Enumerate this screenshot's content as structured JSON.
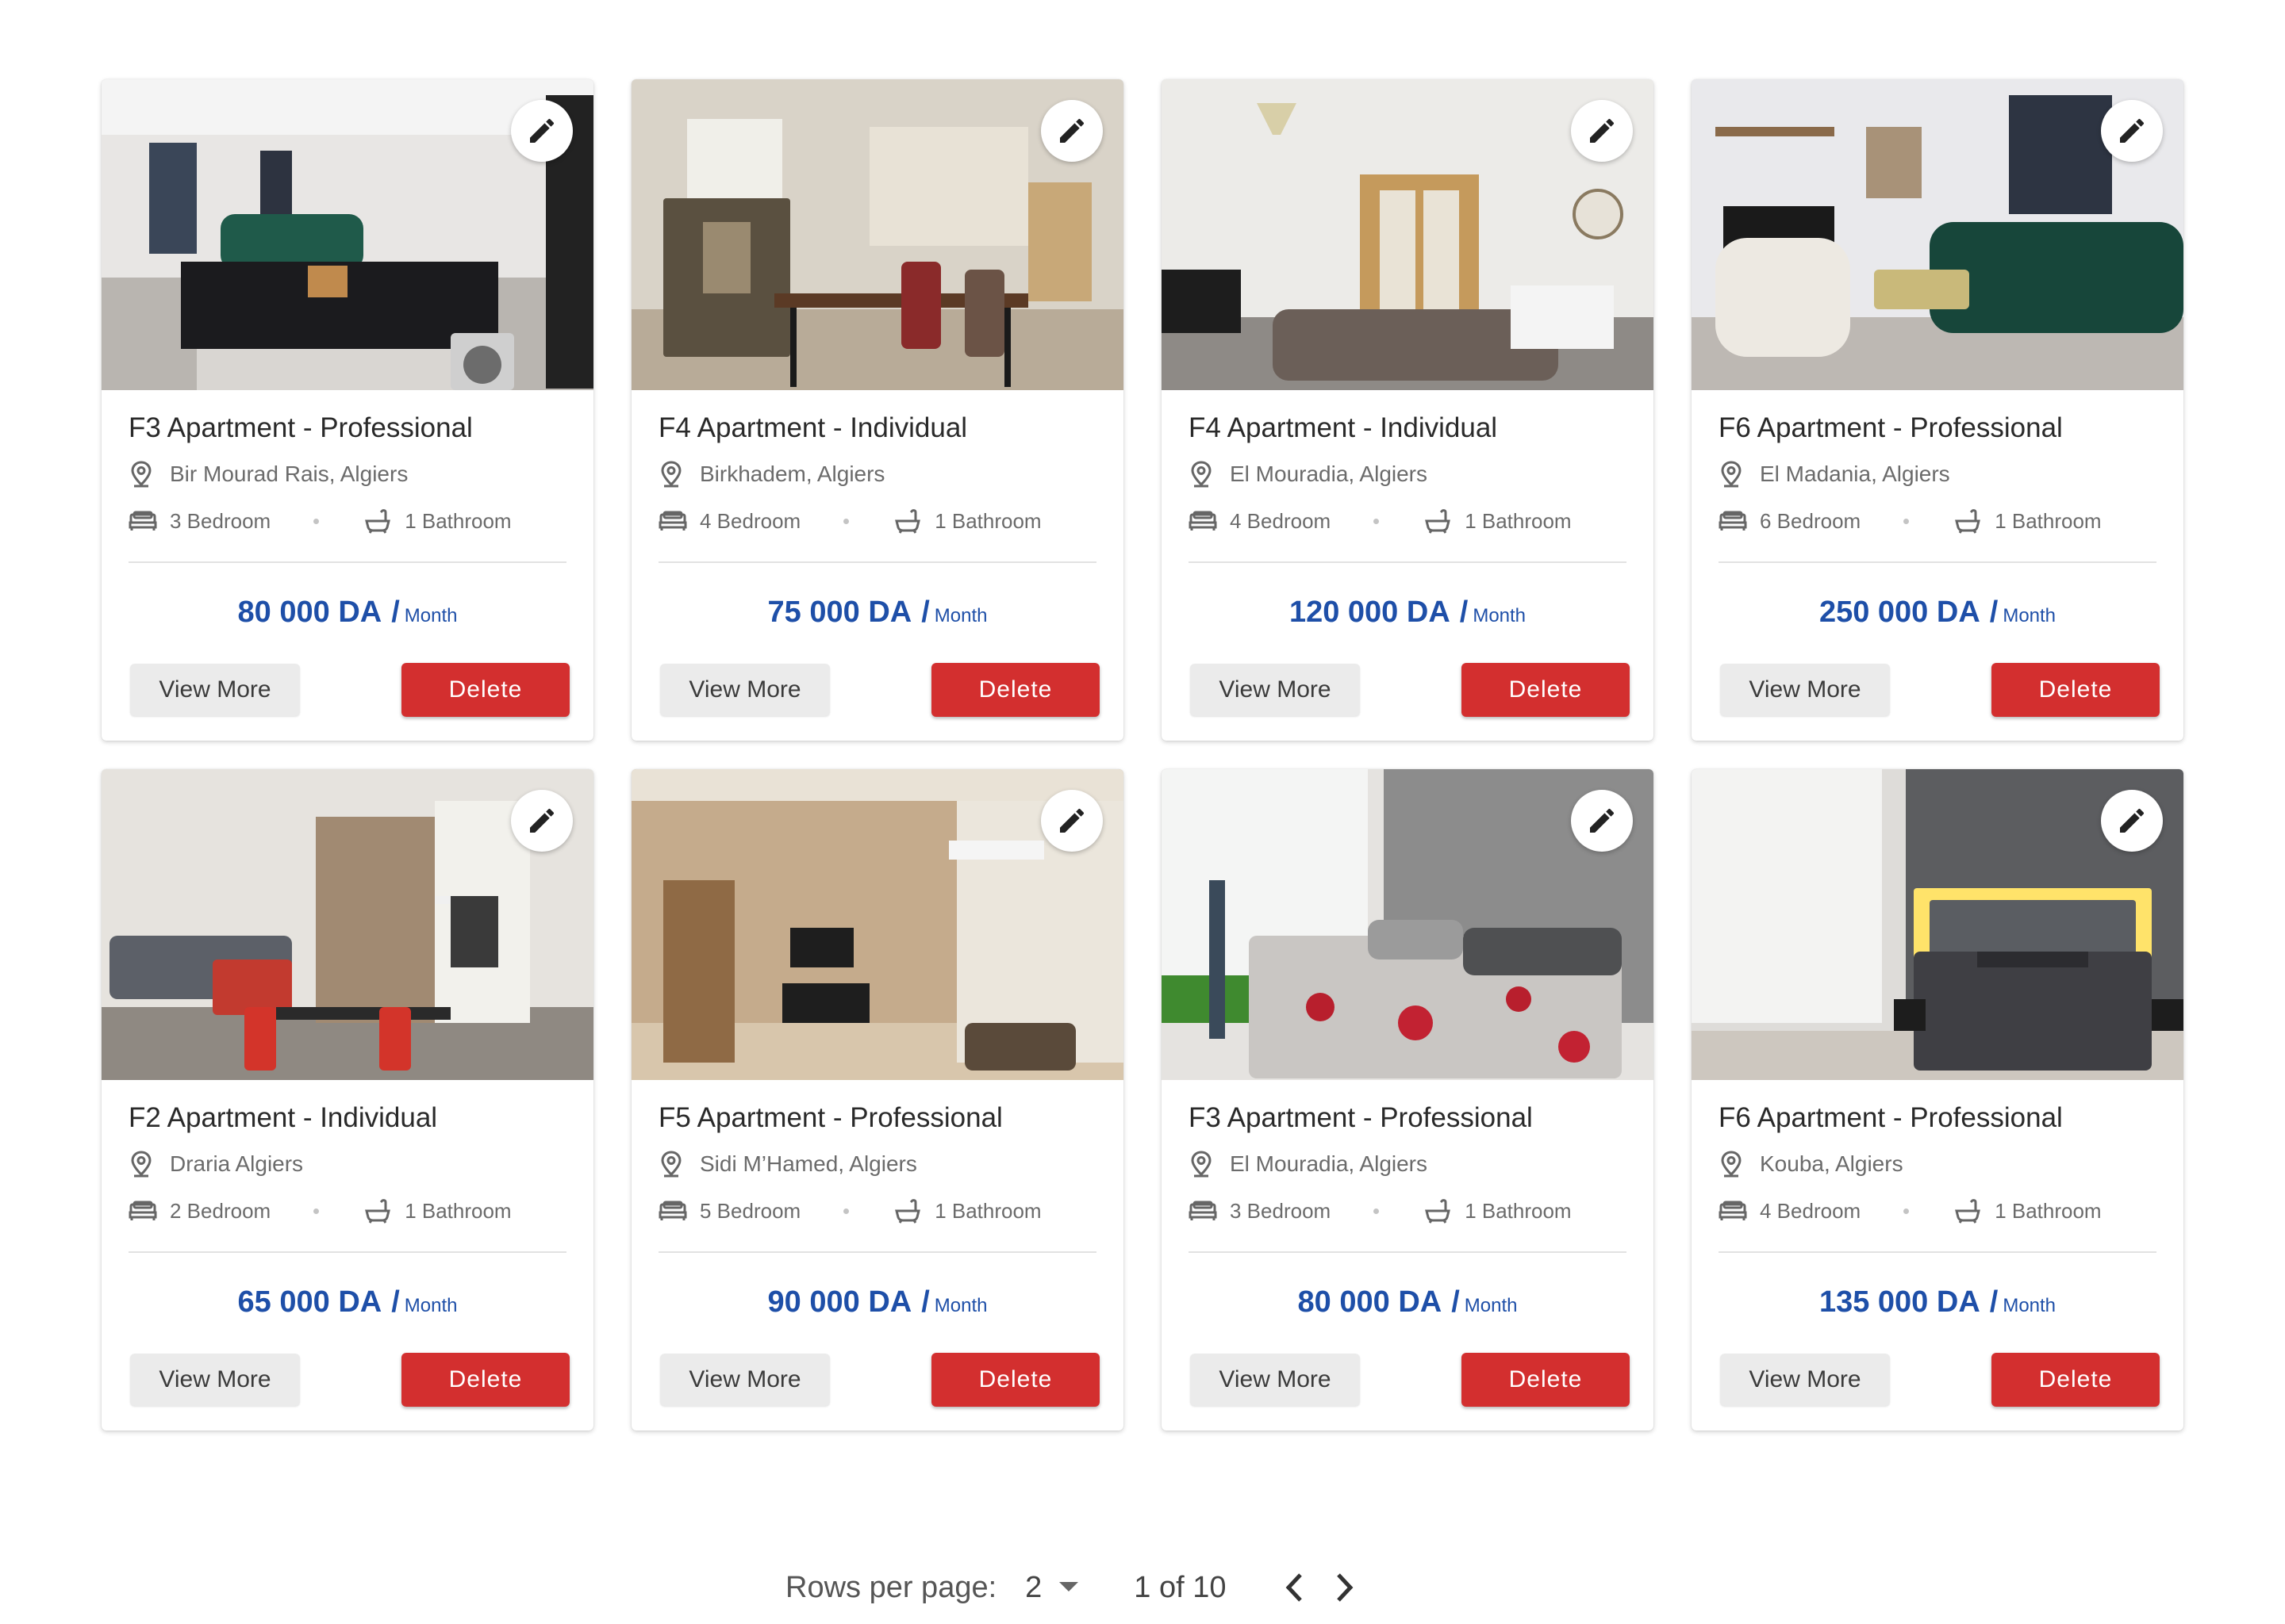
{
  "listings": [
    {
      "title": "F3 Apartment -  Professional",
      "location": "Bir Mourad Rais, Algiers",
      "bedrooms": "3 Bedroom",
      "bathrooms": "1 Bathroom",
      "price": "80 000 DA",
      "slash": "/",
      "period": "Month",
      "view_label": "View More",
      "delete_label": "Delete",
      "scene": "kitchen"
    },
    {
      "title": "F4 Apartment - Individual",
      "location": "Birkhadem, Algiers",
      "bedrooms": "4 Bedroom",
      "bathrooms": "1 Bathroom",
      "price": "75 000 DA",
      "slash": "/",
      "period": "Month",
      "view_label": "View More",
      "delete_label": "Delete",
      "scene": "dining"
    },
    {
      "title": "F4 Apartment -  Individual",
      "location": "El Mouradia, Algiers",
      "bedrooms": "4 Bedroom",
      "bathrooms": "1 Bathroom",
      "price": "120 000 DA",
      "slash": "/",
      "period": "Month",
      "view_label": "View More",
      "delete_label": "Delete",
      "scene": "living-sofa"
    },
    {
      "title": "F6 Apartment -  Professional",
      "location": "El Madania, Algiers",
      "bedrooms": "6 Bedroom",
      "bathrooms": "1 Bathroom",
      "price": "250 000 DA",
      "slash": "/",
      "period": "Month",
      "view_label": "View More",
      "delete_label": "Delete",
      "scene": "living-green"
    },
    {
      "title": "F2 Apartment - Individual",
      "location": "Draria Algiers",
      "bedrooms": "2 Bedroom",
      "bathrooms": "1 Bathroom",
      "price": "65 000 DA",
      "slash": "/",
      "period": "Month",
      "view_label": "View More",
      "delete_label": "Delete",
      "scene": "living-red"
    },
    {
      "title": "F5 Apartment -  Professional",
      "location": "Sidi M’Hamed, Algiers",
      "bedrooms": "5 Bedroom",
      "bathrooms": "1 Bathroom",
      "price": "90 000 DA",
      "slash": "/",
      "period": "Month",
      "view_label": "View More",
      "delete_label": "Delete",
      "scene": "empty-room"
    },
    {
      "title": "F3 Apartment -  Professional",
      "location": "El Mouradia, Algiers",
      "bedrooms": "3 Bedroom",
      "bathrooms": "1 Bathroom",
      "price": "80 000 DA",
      "slash": "/",
      "period": "Month",
      "view_label": "View More",
      "delete_label": "Delete",
      "scene": "bedroom-floral"
    },
    {
      "title": "F6 Apartment -  Professional",
      "location": "Kouba, Algiers",
      "bedrooms": "4 Bedroom",
      "bathrooms": "1 Bathroom",
      "price": "135 000 DA",
      "slash": "/",
      "period": "Month",
      "view_label": "View More",
      "delete_label": "Delete",
      "scene": "bedroom-dark"
    }
  ],
  "pagination": {
    "rows_label": "Rows per page:",
    "rows_value": "2",
    "range": "1 of 10"
  },
  "colors": {
    "price": "#1e4fa8",
    "delete": "#d32f2f"
  }
}
